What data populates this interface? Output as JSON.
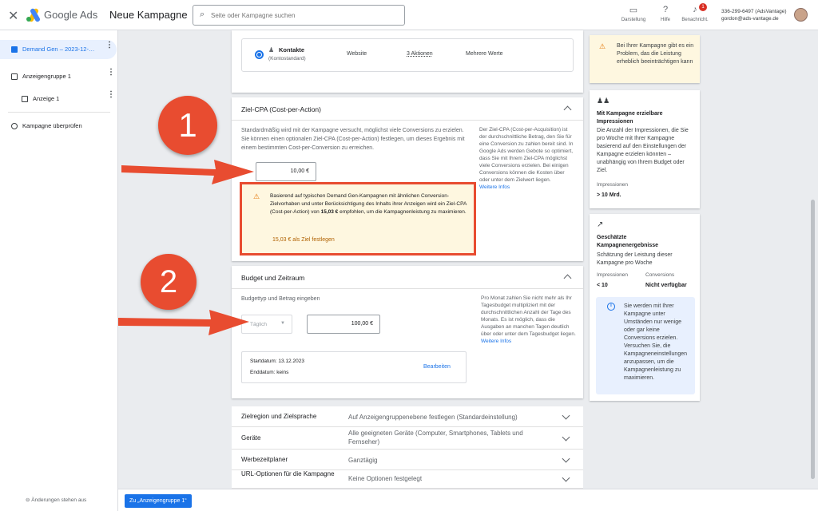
{
  "header": {
    "brand": "Google Ads",
    "campaign_title": "Neue Kampagne",
    "search_placeholder": "Seite oder Kampagne suchen",
    "appearance_label": "Darstellung",
    "help_label": "Hilfe",
    "notifications_label": "Benachricht.",
    "notifications_count": "1",
    "account_id": "336-299-6497 (AdsVantage)",
    "account_email": "gordon@ads-vantage.de"
  },
  "sidebar": {
    "items": [
      {
        "label": "Demand Gen – 2023-12-…"
      },
      {
        "label": "Anzeigengruppe 1"
      },
      {
        "label": "Anzeige 1"
      },
      {
        "label": "Kampagne überprüfen"
      }
    ],
    "footer": "Änderungen stehen aus"
  },
  "conversion": {
    "goal": "Kontakte",
    "goal_sub": "(Kontostandard)",
    "source": "Website",
    "actions": "3 Aktionen",
    "values": "Mehrere Werte"
  },
  "target_cpa": {
    "title": "Ziel-CPA (Cost-per-Action)",
    "description": "Standardmäßig wird mit der Kampagne versucht, möglichst viele Conversions zu erzielen. Sie können einen optionalen Ziel-CPA (Cost-per-Action) festlegen, um dieses Ergebnis mit einem bestimmten Cost-per-Conversion zu erreichen.",
    "value": "10,00 €",
    "help_text": "Der Ziel-CPA (Cost-per-Acquisition) ist der durchschnittliche Betrag, den Sie für eine Conversion zu zahlen bereit sind. In Google Ads werden Gebote so optimiert, dass Sie mit Ihrem Ziel-CPA möglichst viele Conversions erzielen. Bei einigen Conversions können die Kosten über oder unter dem Zielwert liegen.",
    "help_link": "Weitere Infos",
    "warning_pre": "Basierend auf typischen Demand Gen-Kampagnen mit ähnlichen Conversion-Zielvorhaben und unter Berücksichtigung des Inhalts ihrer Anzeigen wird ein Ziel-CPA (Cost-per-Action) von",
    "warning_value": "15,03 €",
    "warning_post": "empfohlen, um die Kampagnenleistung zu maximieren.",
    "warning_action": "15,03 € als Ziel festlegen"
  },
  "budget": {
    "title": "Budget und Zeitraum",
    "subtitle": "Budgettyp und Betrag eingeben",
    "type": "Täglich",
    "amount": "100,00 €",
    "help_text": "Pro Monat zahlen Sie nicht mehr als Ihr Tagesbudget multipliziert mit der durchschnittlichen Anzahl der Tage des Monats. Es ist möglich, dass die Ausgaben an manchen Tagen deutlich über oder unter dem Tagesbudget liegen.",
    "help_link": "Weitere Infos",
    "start": "Startdatum: 13.12.2023",
    "end": "Enddatum: keins",
    "edit": "Bearbeiten"
  },
  "collapsed_sections": [
    {
      "key": "Zielregion und Zielsprache",
      "value": "Auf Anzeigengruppenebene festlegen (Standardeinstellung)"
    },
    {
      "key": "Geräte",
      "value": "Alle geeigneten Geräte (Computer, Smartphones, Tablets und Fernseher)"
    },
    {
      "key": "Werbezeitplaner",
      "value": "Ganztägig"
    },
    {
      "key": "URL-Optionen für die Kampagne",
      "value": "Keine Optionen festgelegt"
    }
  ],
  "right_panel": {
    "alert": "Bei Ihrer Kampagne gibt es ein Problem, das die Leistung erheblich beeinträchtigen kann",
    "reach_title": "Mit Kampagne erzielbare Impressionen",
    "reach_text": "Die Anzahl der Impressionen, die Sie pro Woche mit Ihrer Kampagne basierend auf den Einstellungen der Kampagne erzielen könnten – unabhängig von Ihrem Budget oder Ziel.",
    "reach_label": "Impressionen",
    "reach_value": "> 10 Mrd.",
    "results_title": "Geschätzte Kampagnenergebnisse",
    "results_text": "Schätzung der Leistung dieser Kampagne pro Woche",
    "impr_label": "Impressionen",
    "impr_value": "< 10",
    "conv_label": "Conversions",
    "conv_value": "Nicht verfügbar",
    "info": "Sie werden mit Ihrer Kampagne unter Umständen nur wenige oder gar keine Conversions erzielen. Versuchen Sie, die Kampagneneinstellungen anzupassen, um die Kampagnenleistung zu maximieren."
  },
  "footer": {
    "next_button": "Zu „Anzeigengruppe 1“"
  },
  "annotations": {
    "step1": "1",
    "step2": "2"
  },
  "colors": {
    "accent": "#1a73e8",
    "warning_bg": "#fef7e0",
    "annotation": "#e84c30"
  }
}
